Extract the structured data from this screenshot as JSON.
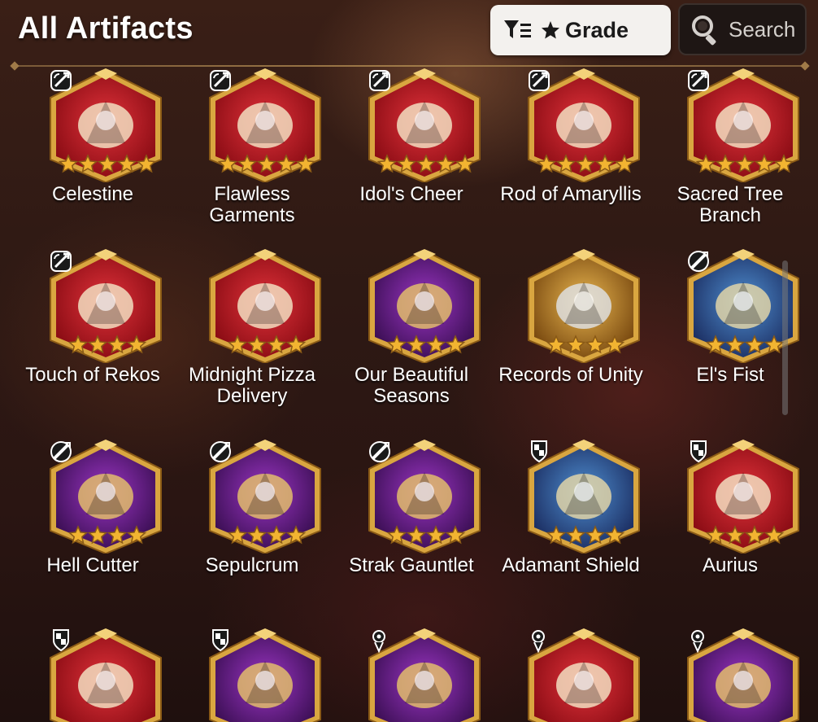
{
  "header": {
    "title": "All Artifacts",
    "grade_button_label": "Grade",
    "search_button_label": "Search"
  },
  "colors": {
    "frame_gold": "#d9a640",
    "star_gold": "#f2b431",
    "bg_red": "#b0151c",
    "bg_purple": "#5a1a70",
    "bg_gold": "#8a5a16"
  },
  "artifacts": [
    {
      "name": "Celestine",
      "stars": 5,
      "class": "knight",
      "bg": "red"
    },
    {
      "name": "Flawless Garments",
      "stars": 5,
      "class": "knight",
      "bg": "red"
    },
    {
      "name": "Idol's Cheer",
      "stars": 5,
      "class": "knight",
      "bg": "red"
    },
    {
      "name": "Rod of Amaryllis",
      "stars": 5,
      "class": "knight",
      "bg": "red"
    },
    {
      "name": "Sacred Tree Branch",
      "stars": 5,
      "class": "knight",
      "bg": "red"
    },
    {
      "name": "Touch of Rekos",
      "stars": 4,
      "class": "knight",
      "bg": "red"
    },
    {
      "name": "Midnight Pizza Delivery",
      "stars": 4,
      "class": "none",
      "bg": "red"
    },
    {
      "name": "Our Beautiful Seasons",
      "stars": 4,
      "class": "none",
      "bg": "purple"
    },
    {
      "name": "Records of Unity",
      "stars": 4,
      "class": "none",
      "bg": "gold"
    },
    {
      "name": "El's Fist",
      "stars": 4,
      "class": "warrior",
      "bg": "blue"
    },
    {
      "name": "Hell Cutter",
      "stars": 4,
      "class": "warrior",
      "bg": "purple"
    },
    {
      "name": "Sepulcrum",
      "stars": 4,
      "class": "warrior",
      "bg": "purple"
    },
    {
      "name": "Strak Gauntlet",
      "stars": 4,
      "class": "warrior",
      "bg": "purple"
    },
    {
      "name": "Adamant Shield",
      "stars": 4,
      "class": "shield",
      "bg": "blue"
    },
    {
      "name": "Aurius",
      "stars": 4,
      "class": "shield",
      "bg": "red"
    },
    {
      "name": "",
      "stars": 0,
      "class": "shield",
      "bg": "red"
    },
    {
      "name": "",
      "stars": 0,
      "class": "shield",
      "bg": "purple"
    },
    {
      "name": "",
      "stars": 0,
      "class": "mage",
      "bg": "purple"
    },
    {
      "name": "",
      "stars": 0,
      "class": "mage",
      "bg": "red"
    },
    {
      "name": "",
      "stars": 0,
      "class": "mage",
      "bg": "purple"
    }
  ]
}
